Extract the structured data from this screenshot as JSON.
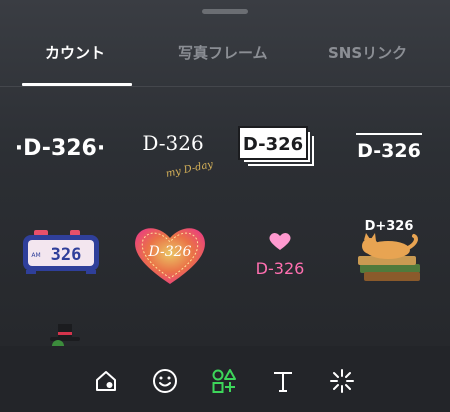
{
  "tabs": [
    {
      "label": "カウント",
      "active": true
    },
    {
      "label": "写真フレーム",
      "active": false
    },
    {
      "label": "SNSリンク",
      "active": false
    }
  ],
  "stickers": {
    "dot_dday": "·D-326·",
    "script_dday": "D-326",
    "script_sub": "my D-day",
    "stack_dday": "D-326",
    "line_dday": "D-326",
    "clock_dday": "326",
    "clock_left_small": "AM",
    "heart_dday": "D-326",
    "pink_dday": "D-326",
    "cat_dday": "D+326"
  },
  "toolbar": [
    "home-sticker-icon",
    "smiley-icon",
    "shapes-icon",
    "text-icon",
    "sparkle-icon"
  ],
  "colors": {
    "background": "#2c2f34",
    "active_tab": "#ffffff",
    "inactive_tab": "#8b8e94",
    "shapes_icon": "#3dd65a",
    "pink": "#ff6fb0",
    "gold": "#d9b45a"
  }
}
